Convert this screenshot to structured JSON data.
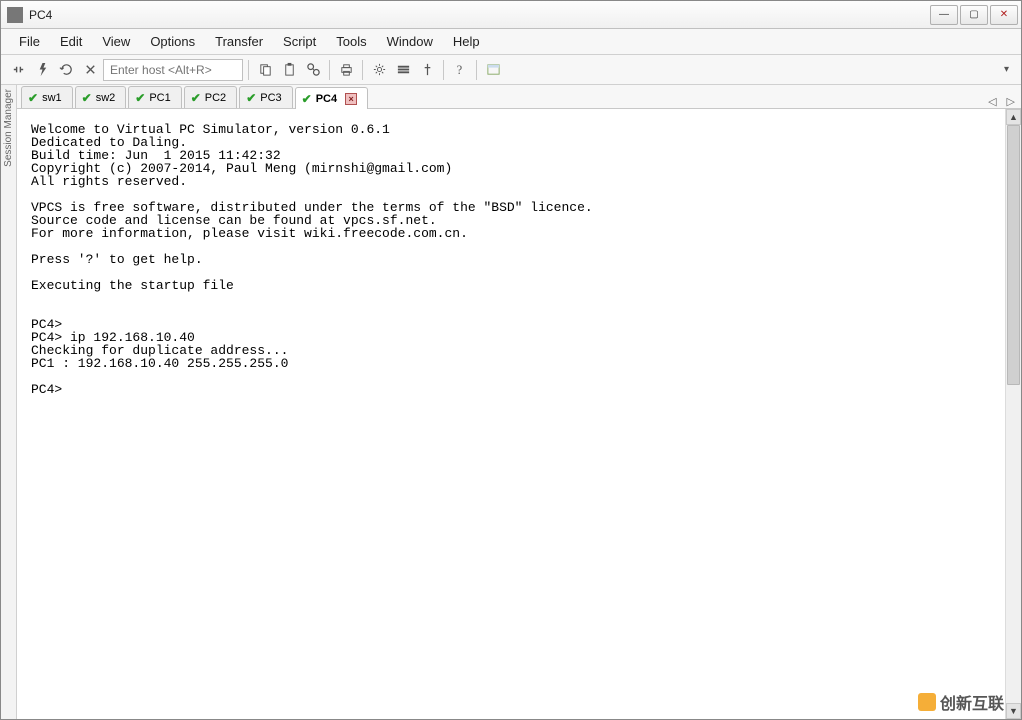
{
  "window": {
    "title": "PC4"
  },
  "menu": {
    "items": [
      "File",
      "Edit",
      "View",
      "Options",
      "Transfer",
      "Script",
      "Tools",
      "Window",
      "Help"
    ]
  },
  "toolbar": {
    "host_placeholder": "Enter host <Alt+R>"
  },
  "sidebar": {
    "label": "Session Manager"
  },
  "tabs": {
    "items": [
      {
        "label": "sw1",
        "active": false
      },
      {
        "label": "sw2",
        "active": false
      },
      {
        "label": "PC1",
        "active": false
      },
      {
        "label": "PC2",
        "active": false
      },
      {
        "label": "PC3",
        "active": false
      },
      {
        "label": "PC4",
        "active": true
      }
    ]
  },
  "terminal": {
    "text": "Welcome to Virtual PC Simulator, version 0.6.1\nDedicated to Daling.\nBuild time: Jun  1 2015 11:42:32\nCopyright (c) 2007-2014, Paul Meng (mirnshi@gmail.com)\nAll rights reserved.\n\nVPCS is free software, distributed under the terms of the \"BSD\" licence.\nSource code and license can be found at vpcs.sf.net.\nFor more information, please visit wiki.freecode.com.cn.\n\nPress '?' to get help.\n\nExecuting the startup file\n\n\nPC4>\nPC4> ip 192.168.10.40\nChecking for duplicate address...\nPC1 : 192.168.10.40 255.255.255.0\n\nPC4>"
  },
  "watermark": {
    "text": "创新互联"
  }
}
